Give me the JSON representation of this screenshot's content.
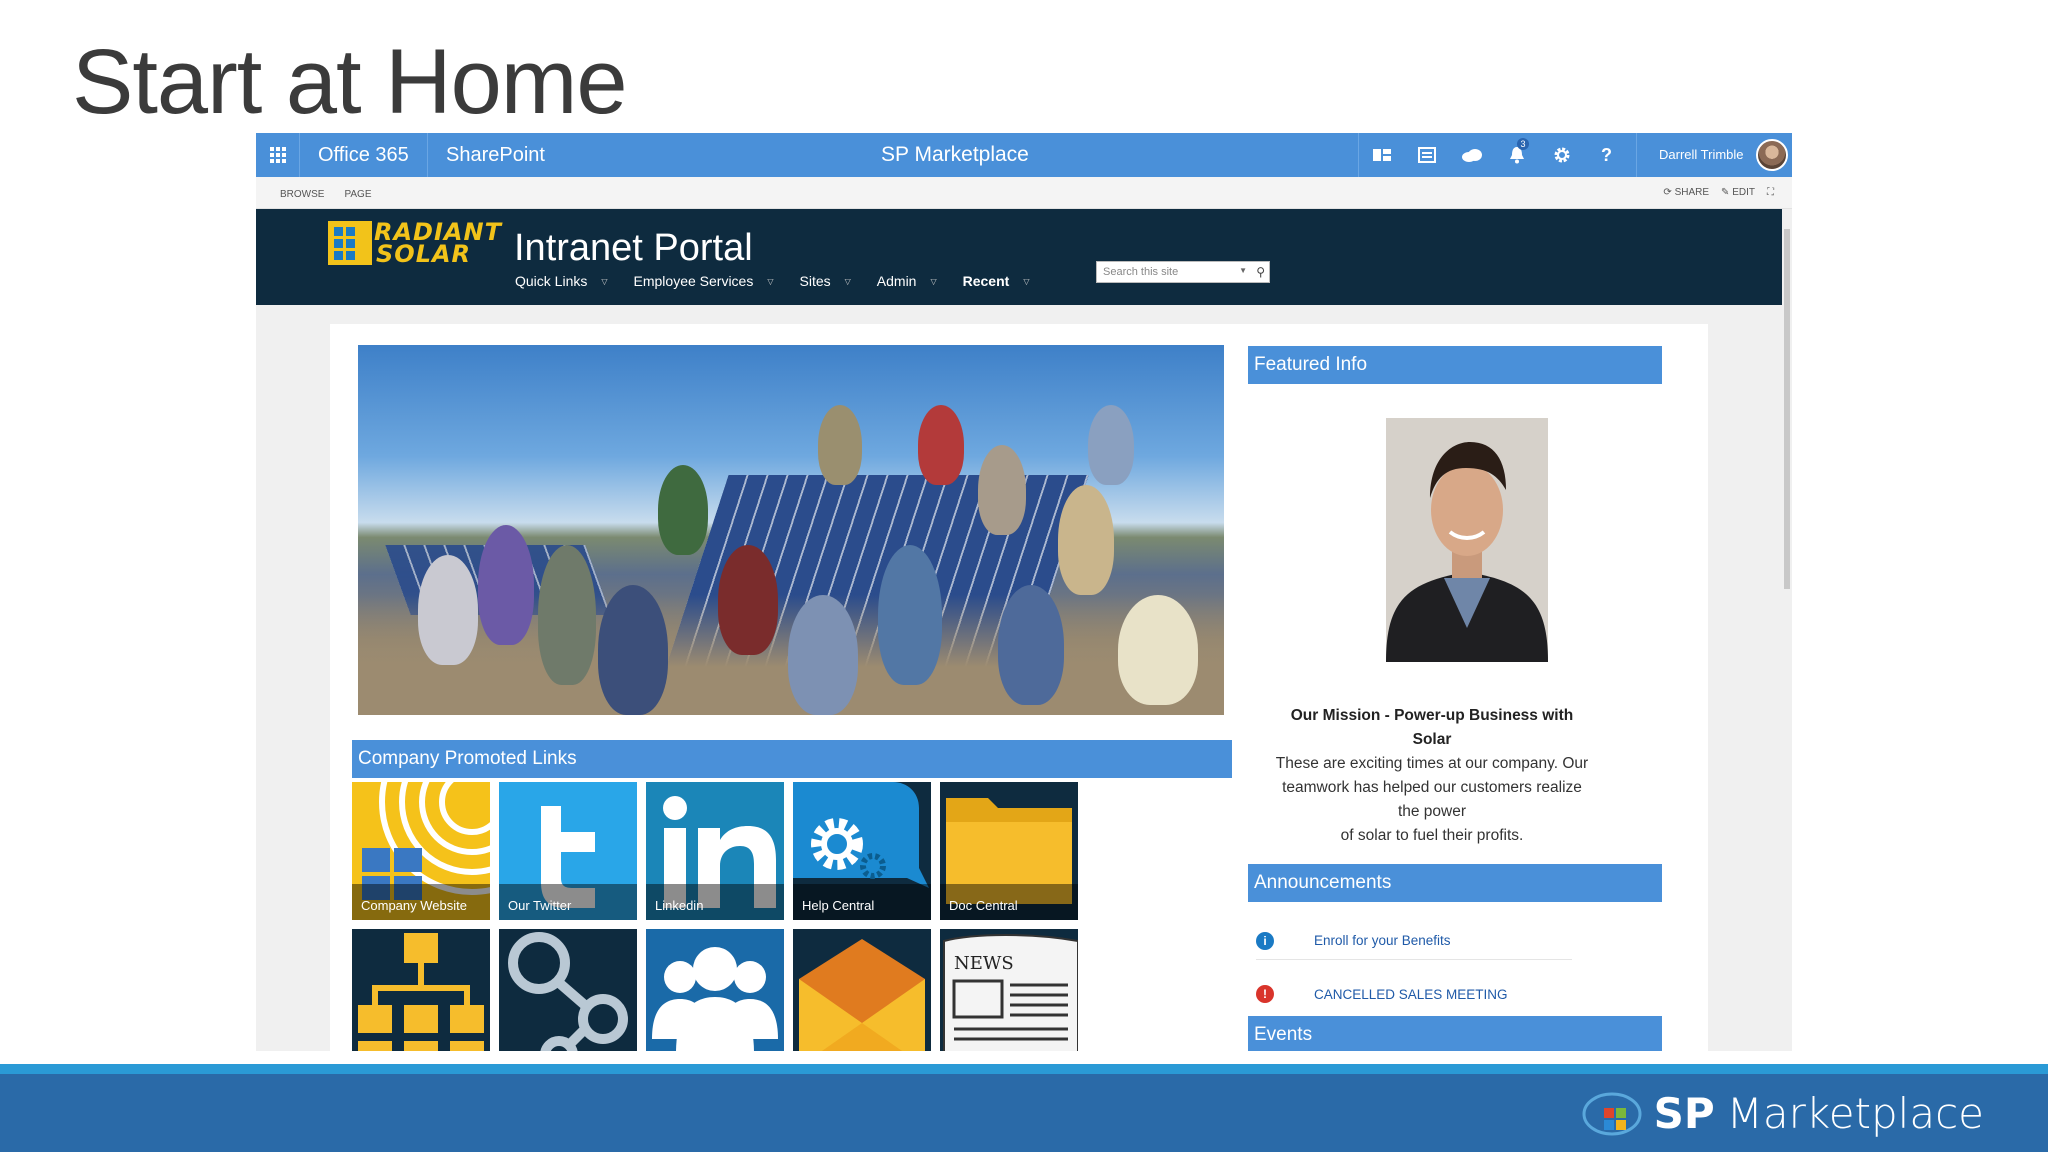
{
  "slide": {
    "title": "Start at Home"
  },
  "suitebar": {
    "office365": "Office 365",
    "sharepoint": "SharePoint",
    "center_title": "SP Marketplace",
    "notification_count": "3",
    "user_name": "Darrell Trimble"
  },
  "ribbon": {
    "browse": "BROWSE",
    "page": "PAGE",
    "share": "SHARE",
    "edit": "EDIT"
  },
  "header": {
    "logo_line1": "RADIANT",
    "logo_line2": "SOLAR",
    "site_title": "Intranet Portal",
    "nav": [
      {
        "label": "Quick Links"
      },
      {
        "label": "Employee Services"
      },
      {
        "label": "Sites"
      },
      {
        "label": "Admin"
      },
      {
        "label": "Recent"
      }
    ],
    "search_placeholder": "Search this site"
  },
  "promoted": {
    "header": "Company Promoted Links",
    "tiles": [
      {
        "label": "Company Website"
      },
      {
        "label": "Our Twitter"
      },
      {
        "label": "Linkedin"
      },
      {
        "label": "Help Central"
      },
      {
        "label": "Doc Central"
      }
    ],
    "news_text": "NEWS"
  },
  "featured": {
    "header": "Featured Info",
    "mission_title": "Our Mission - Power-up Business with Solar",
    "mission_line1": "These are exciting times at our company.  Our",
    "mission_line2": "teamwork has helped our customers realize the power",
    "mission_line3": "of solar to fuel their profits."
  },
  "announcements": {
    "header": "Announcements",
    "items": [
      {
        "icon": "i",
        "text": "Enroll for your Benefits",
        "color": "#1a7ac4"
      },
      {
        "icon": "!",
        "text": "CANCELLED SALES MEETING",
        "color": "#d9342b"
      }
    ]
  },
  "events": {
    "header": "Events"
  },
  "footer": {
    "brand_sp": "SP",
    "brand_name": "Marketplace"
  },
  "colors": {
    "accent": "#4a90d9",
    "header_bg": "#0e2b3f",
    "footer": "#2a6aa8",
    "logo_yellow": "#f2c31a"
  }
}
